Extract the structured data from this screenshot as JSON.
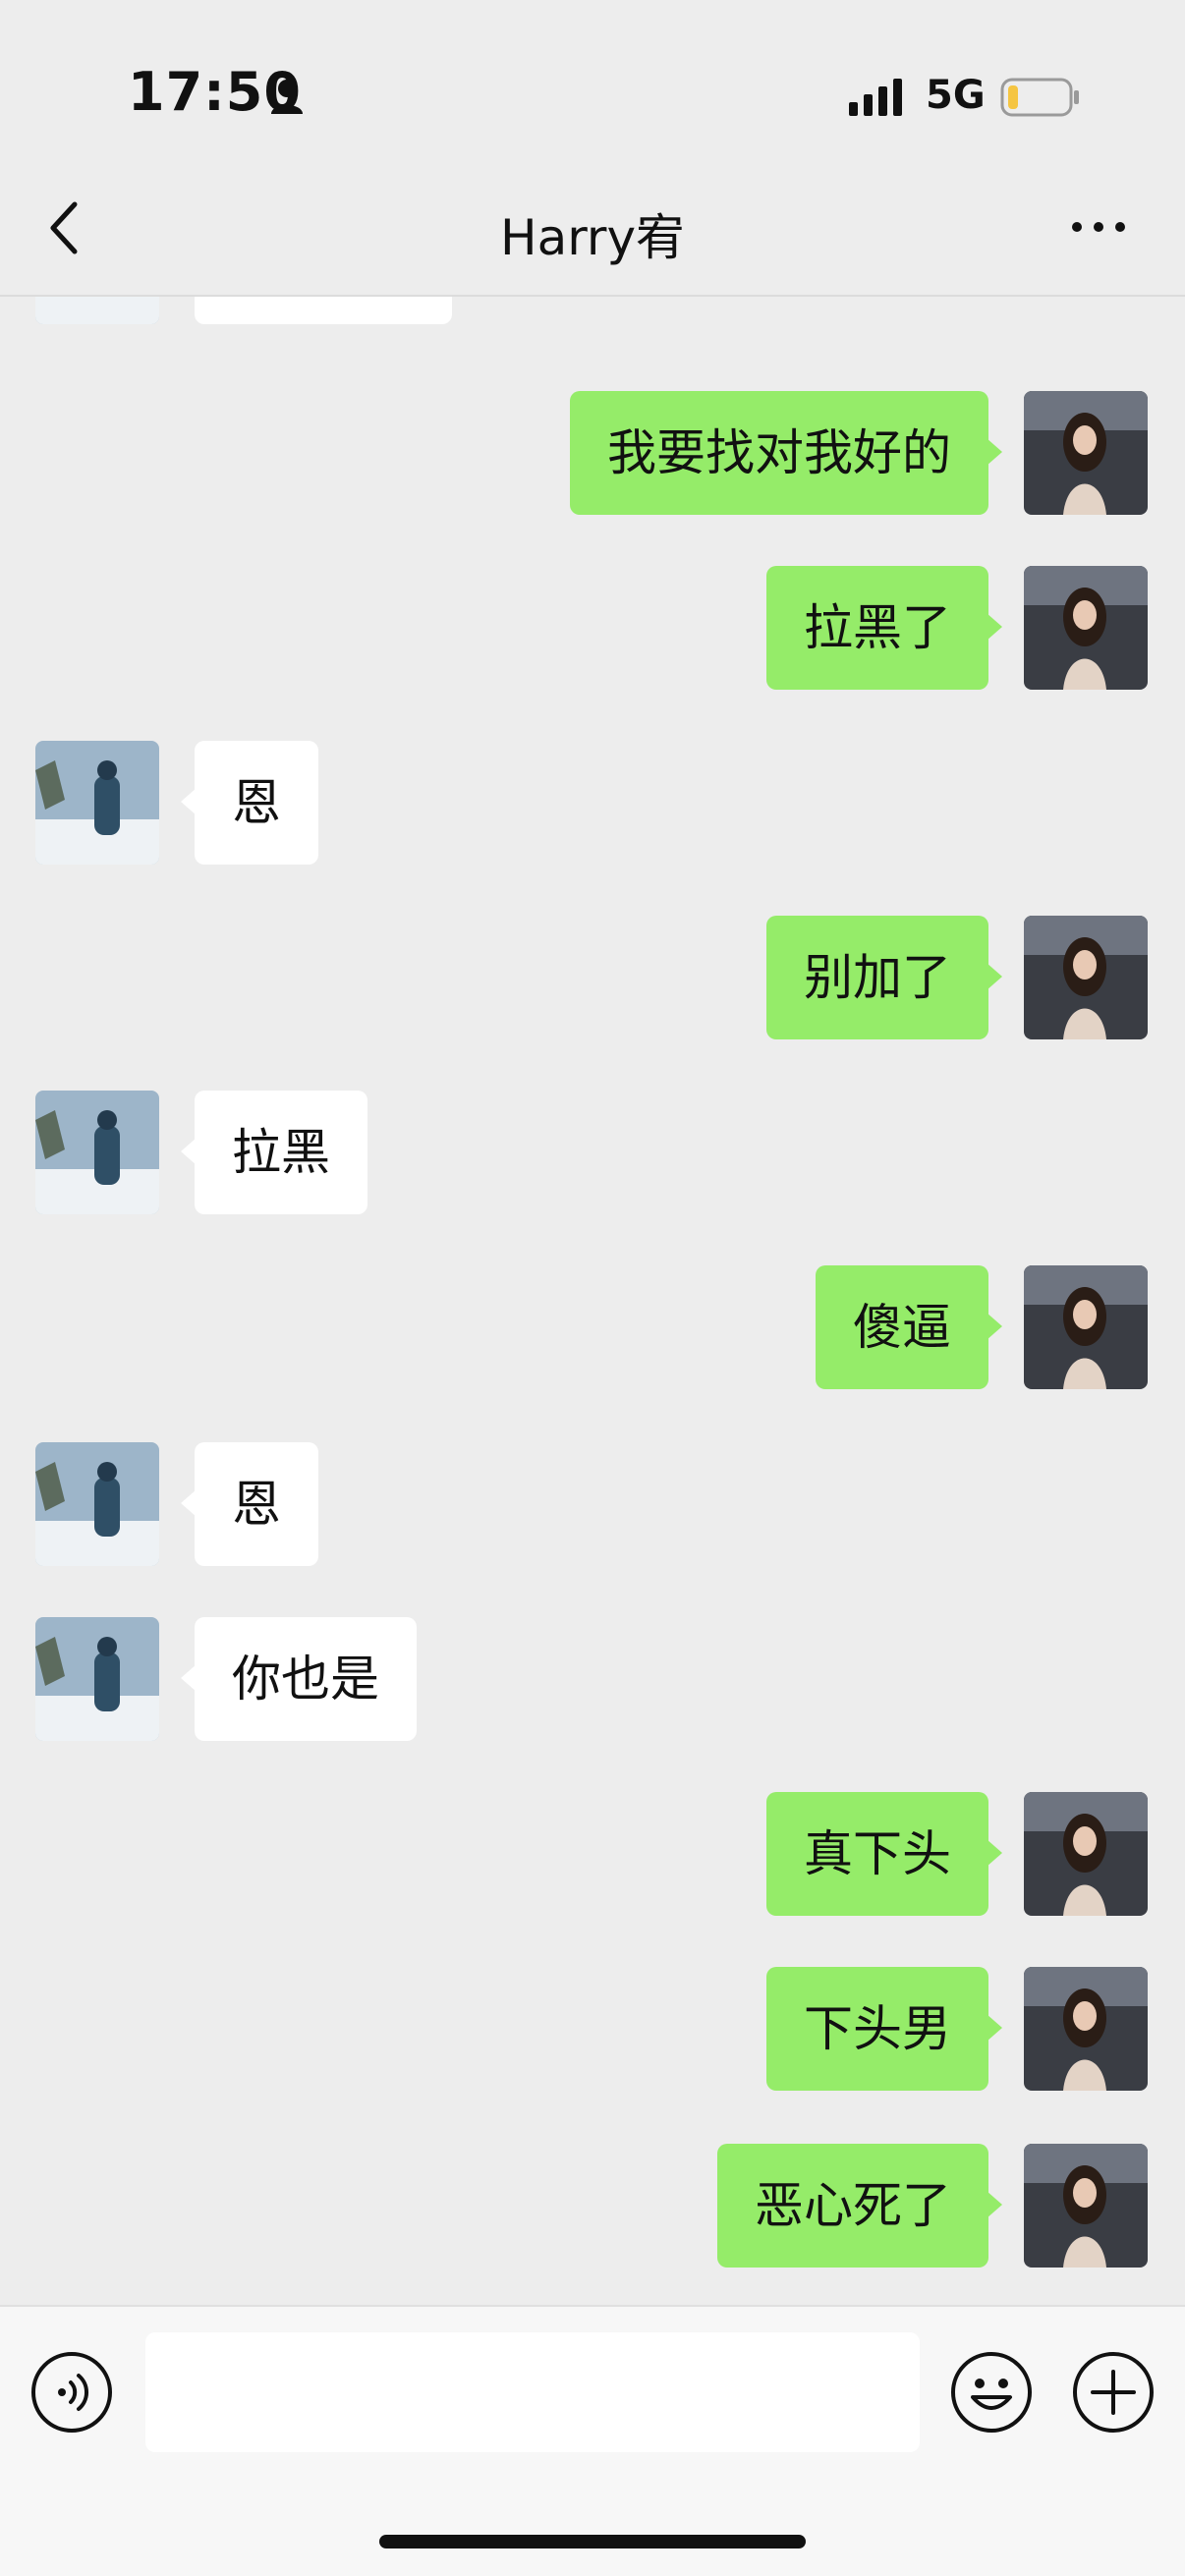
{
  "status_bar": {
    "time": "17:50",
    "network": "5G",
    "battery_color": "#f5c542"
  },
  "header": {
    "title": "Harry宥",
    "back_icon": "chevron-left-icon",
    "more_icon": "more-dots-icon"
  },
  "messages": [
    {
      "side": "right",
      "text": "我要找对我好的"
    },
    {
      "side": "right",
      "text": "拉黑了"
    },
    {
      "side": "left",
      "text": "恩"
    },
    {
      "side": "right",
      "text": "别加了"
    },
    {
      "side": "left",
      "text": "拉黑"
    },
    {
      "side": "right",
      "text": "傻逼"
    },
    {
      "side": "left",
      "text": "恩"
    },
    {
      "side": "left",
      "text": "你也是"
    },
    {
      "side": "right",
      "text": "真下头"
    },
    {
      "side": "right",
      "text": "下头男"
    },
    {
      "side": "right",
      "text": "恶心死了"
    }
  ],
  "input_bar": {
    "value": "",
    "voice_icon": "voice-icon",
    "emoji_icon": "emoji-icon",
    "plus_icon": "plus-icon"
  },
  "colors": {
    "sent_bubble": "#95ec69",
    "received_bubble": "#ffffff",
    "background": "#ededed"
  }
}
